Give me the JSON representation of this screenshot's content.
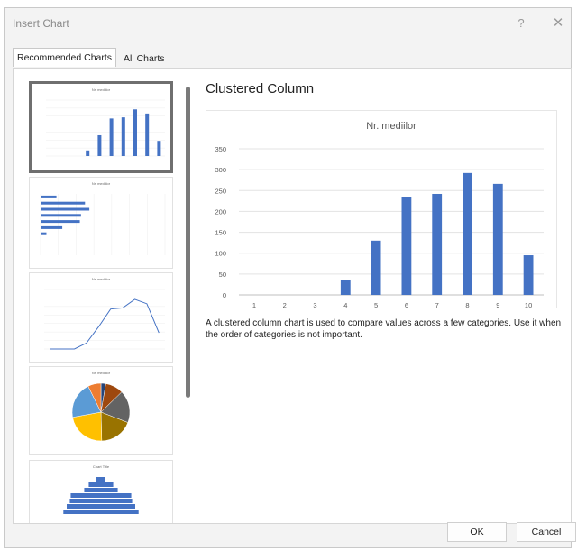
{
  "dialog": {
    "title": "Insert Chart",
    "help_label": "?",
    "close_label": "✕"
  },
  "tabs": [
    {
      "label": "Recommended Charts",
      "active": true
    },
    {
      "label": "All Charts",
      "active": false
    }
  ],
  "thumbnails": [
    {
      "name": "thumb-clustered-column",
      "title": "Nr. mediilor",
      "type": "column",
      "selected": true
    },
    {
      "name": "thumb-clustered-bar",
      "title": "Nr. mediilor",
      "type": "bar",
      "selected": false
    },
    {
      "name": "thumb-line",
      "title": "Nr. mediilor",
      "type": "line",
      "selected": false
    },
    {
      "name": "thumb-pie",
      "title": "Nr. mediilor",
      "type": "pie",
      "selected": false
    },
    {
      "name": "thumb-funnel",
      "title": "Chart Title",
      "type": "funnel",
      "selected": false
    }
  ],
  "preview": {
    "heading": "Clustered Column",
    "description": "A clustered column chart is used to compare values across a few categories. Use it when the order of categories is not important."
  },
  "chart_data": {
    "type": "bar",
    "title": "Nr. mediilor",
    "categories": [
      "1",
      "2",
      "3",
      "4",
      "5",
      "6",
      "7",
      "8",
      "9",
      "10"
    ],
    "values": [
      0,
      0,
      0,
      35,
      130,
      235,
      242,
      292,
      266,
      95
    ],
    "xlabel": "",
    "ylabel": "",
    "ylim": [
      0,
      350
    ],
    "yticks": [
      0,
      50,
      100,
      150,
      200,
      250,
      300,
      350
    ],
    "grid": true,
    "bar_color": "#4472c4"
  },
  "buttons": {
    "ok": "OK",
    "cancel": "Cancel"
  }
}
